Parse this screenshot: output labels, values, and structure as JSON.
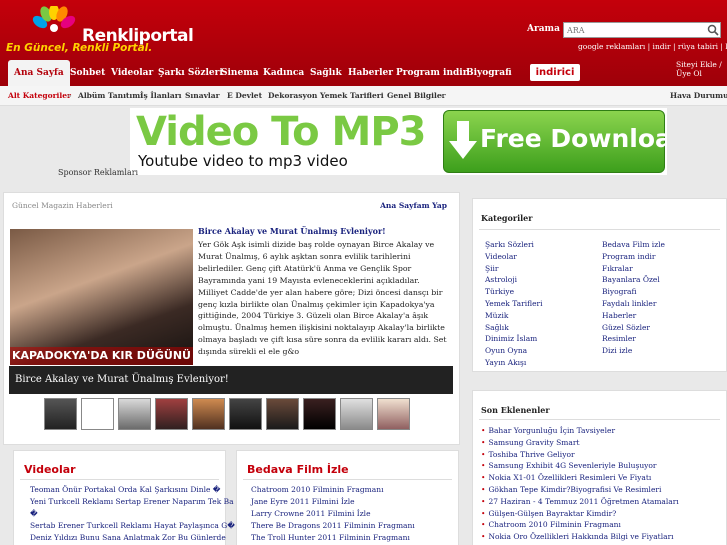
{
  "brand": {
    "name": "Renkliportal",
    "slogan": "En Güncel, Renkli Portal."
  },
  "search": {
    "label": "Arama",
    "placeholder": "ARA"
  },
  "quicklinks": "google reklamları | indir | rüya tabiri | konik",
  "history_link": "Siteyi Ekle / Üye Ol",
  "nav": [
    "Ana Sayfa",
    "Sohbet",
    "Videolar",
    "Şarkı Sözleri",
    "Sinema",
    "Kadınca",
    "Sağlık",
    "Haberler",
    "Program indir",
    "Biyografi"
  ],
  "indirici": "indirici",
  "subnav": {
    "all": "Alt Kategoriler",
    "items": [
      "Albüm Tanıtımı",
      "İş İlanları",
      "Sınavlar",
      "E Devlet",
      "Dekorasyon",
      "Yemek Tarifleri",
      "Genel Bilgiler"
    ],
    "weather": "Hava Durumu"
  },
  "ad": {
    "title": "Video To MP3",
    "subtitle": "Youtube video to mp3 video",
    "button": "Free Download"
  },
  "sponsor": "Sponsor Reklamları",
  "news": {
    "section": "Güncel Magazin Haberleri",
    "home_link": "Ana Sayfam Yap",
    "title": "Birce Akalay ve Murat Ünalmış Evleniyor!",
    "image_caption": "KAPADOKYA'DA KIR DÜĞÜNÜ",
    "body": "Yer Gök Aşk isimli dizide baş rolde oynayan Birce Akalay ve Murat Ünalmış, 6 aylık aşktan sonra evlilik tarihlerini belirlediler. Genç çift Atatürk'ü Anma ve Gençlik Spor Bayramında yani 19 Mayısta evleneceklerini açıkladılar. Milliyet Cadde'de yer alan habere göre; Dizi öncesi dansçı bir genç kızla birlikte olan Ünalmış çekimler için Kapadokya'ya gittiğinde, 2004 Türkiye 3. Güzeli olan Birce Akalay'a âşık olmuştu. Ünalmış hemen ilişkisini noktalayıp Akalay'la birlikte olmaya başladı ve çift kısa süre sonra da evlilik kararı aldı. Set dışında sürekli el ele g&o",
    "slider_title": "Birce Akalay ve Murat Ünalmış Evleniyor!"
  },
  "videolar": {
    "title": "Videolar",
    "items": [
      "Teoman Önür Portakal Orda Kal Şarkısını Dinle �",
      "Yeni Turkcell Reklamı Sertap Erener Naparım Tek Ba",
      "�",
      "Sertab Erener Turkcell Reklamı Hayat Paylaşınca G�",
      "Deniz Yıldızı Bunu Sana Anlatmak Zor Bu Günlerde"
    ]
  },
  "filmler": {
    "title": "Bedava Film İzle",
    "items": [
      "Chatroom 2010 Filminin Fragmanı",
      "Jane Eyre 2011 Filmini İzle",
      "Larry Crowne 2011 Filmini İzle",
      "There Be Dragons 2011 Filminin Fragmanı",
      "The Troll Hunter 2011 Filminin Fragmanı"
    ]
  },
  "kategoriler": {
    "title": "Kategoriler",
    "col1": [
      "Şarkı Sözleri",
      "Videolar",
      "Şiir",
      "Astroloji",
      "Türkiye",
      "Yemek Tarifleri",
      "Müzik",
      "Sağlık",
      "Dinimiz İslam",
      "Oyun Oyna",
      "Yayın Akışı"
    ],
    "col2": [
      "Bedava Film izle",
      "Program indir",
      "Fıkralar",
      "Bayanlara Özel",
      "Biyografi",
      "Faydalı linkler",
      "Haberler",
      "Güzel Sözler",
      "Resimler",
      "Dizi izle"
    ]
  },
  "son_eklenenler": {
    "title": "Son Eklenenler",
    "items": [
      "Bahar Yorgunluğu İçin Tavsiyeler",
      "Samsung Gravity Smart",
      "Toshiba Thrive Geliyor",
      "Samsung Exhibit 4G Sevenleriyle Buluşuyor",
      "Nokia X1-01 Özellikleri Resimleri Ve Fiyatı",
      "Gökhan Tepe Kimdir?Biyografisi Ve Resimleri",
      "27 Haziran - 4 Temmuz 2011 Öğretmen Atamaları",
      "Gülşen-Gülşen Bayraktar Kimdir?",
      "Chatroom 2010 Filminin Fragmanı",
      "Nokia Oro Özellikleri Hakkında Bilgi ve Fiyatları"
    ]
  },
  "colors": {
    "brand_red": "#b3000a",
    "accent_yellow": "#ffd200",
    "link_blue": "#1a237e"
  }
}
